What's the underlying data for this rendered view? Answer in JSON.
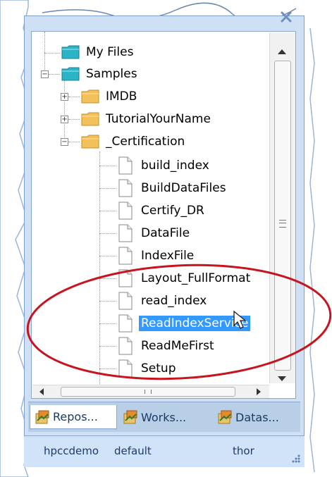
{
  "tree": {
    "items": [
      {
        "label": "My Files",
        "type": "folder-cyan"
      },
      {
        "label": "Samples",
        "type": "folder-cyan"
      },
      {
        "label": "IMDB",
        "type": "folder"
      },
      {
        "label": "TutorialYourName",
        "type": "folder"
      },
      {
        "label": "_Certification",
        "type": "folder"
      },
      {
        "label": "build_index",
        "type": "file"
      },
      {
        "label": "BuildDataFiles",
        "type": "file"
      },
      {
        "label": "Certify_DR",
        "type": "file"
      },
      {
        "label": "DataFile",
        "type": "file"
      },
      {
        "label": "IndexFile",
        "type": "file"
      },
      {
        "label": "Layout_FullFormat",
        "type": "file"
      },
      {
        "label": "read_index",
        "type": "file"
      },
      {
        "label": "ReadIndexService",
        "type": "file",
        "selected": true
      },
      {
        "label": "ReadMeFirst",
        "type": "file"
      },
      {
        "label": "Setup",
        "type": "file"
      }
    ]
  },
  "tabs": [
    {
      "label": "Repos...",
      "active": true
    },
    {
      "label": "Works..."
    },
    {
      "label": "Datas..."
    }
  ],
  "statusbar": {
    "user": "hpccdemo",
    "config": "default",
    "cluster": "thor"
  },
  "colors": {
    "selection": "#3399ff",
    "annotation": "#c8141e",
    "window_frame": "#cfe0f5"
  }
}
